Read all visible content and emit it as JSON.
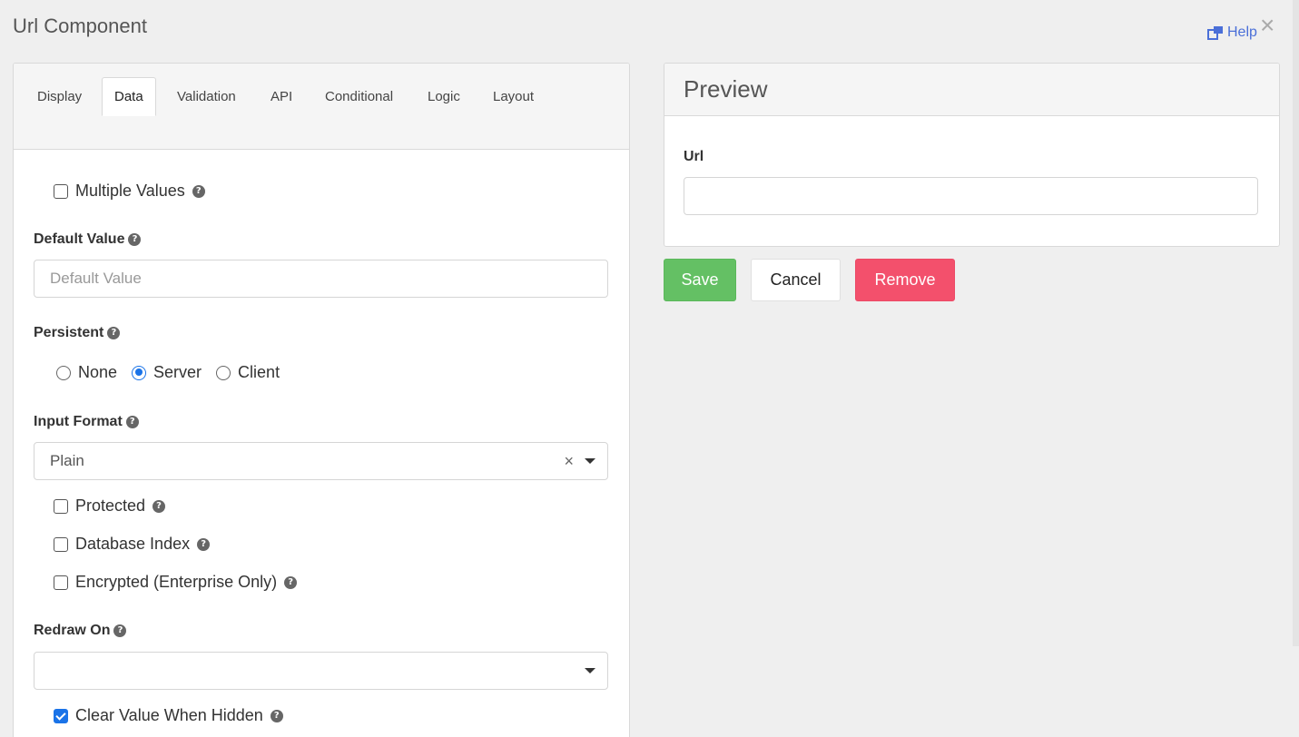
{
  "modal": {
    "title": "Url Component",
    "help_label": "Help",
    "close_glyph": "×"
  },
  "tabs": [
    {
      "label": "Display",
      "active": false
    },
    {
      "label": "Data",
      "active": true
    },
    {
      "label": "Validation",
      "active": false
    },
    {
      "label": "API",
      "active": false
    },
    {
      "label": "Conditional",
      "active": false
    },
    {
      "label": "Logic",
      "active": false
    },
    {
      "label": "Layout",
      "active": false
    }
  ],
  "form": {
    "multiple_values": {
      "label": "Multiple Values",
      "checked": false
    },
    "default_value": {
      "label": "Default Value",
      "placeholder": "Default Value",
      "value": ""
    },
    "persistent": {
      "label": "Persistent",
      "options": [
        "None",
        "Server",
        "Client"
      ],
      "selected": "Server"
    },
    "input_format": {
      "label": "Input Format",
      "value": "Plain",
      "clear_glyph": "×"
    },
    "protected": {
      "label": "Protected",
      "checked": false
    },
    "database_index": {
      "label": "Database Index",
      "checked": false
    },
    "encrypted": {
      "label": "Encrypted (Enterprise Only)",
      "checked": false
    },
    "redraw_on": {
      "label": "Redraw On",
      "value": ""
    },
    "clear_value_when_hidden": {
      "label": "Clear Value When Hidden",
      "checked": true
    },
    "help_glyph": "?"
  },
  "preview": {
    "title": "Preview",
    "field_label": "Url",
    "field_value": ""
  },
  "buttons": {
    "save": "Save",
    "cancel": "Cancel",
    "remove": "Remove"
  },
  "colors": {
    "accent": "#1a73e8",
    "save": "#64c064",
    "remove": "#f3506c",
    "help_link": "#4a6fd8"
  }
}
